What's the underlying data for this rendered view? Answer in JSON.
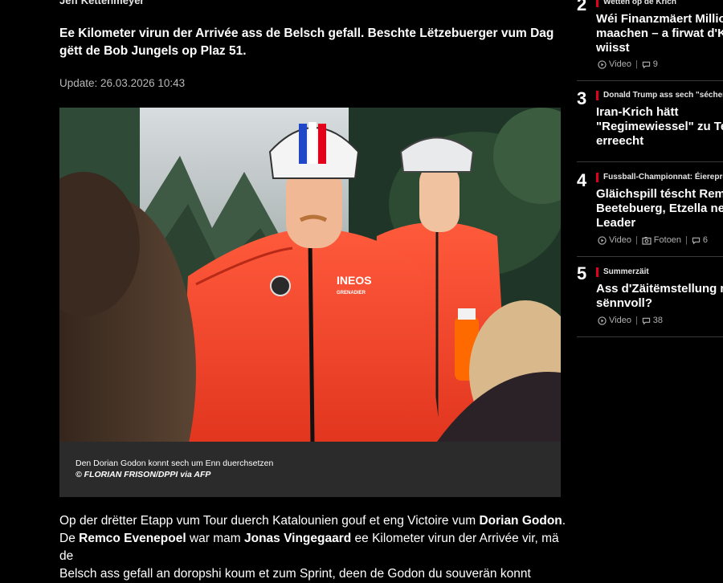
{
  "article": {
    "author": "Jeff Kettenmeyer",
    "lead": "Ee Kilometer virun der Arrivée ass de Belsch gefall. Beschte Lëtzebuerger vum Dag gëtt de Bob Jungels op Plaz 51.",
    "update": "Update: 26.03.2026 10:43",
    "caption": "Den Dorian Godon konnt sech um Enn duerchsetzen",
    "credit": "© FLORIAN FRISON/DPPI via AFP",
    "jersey_text": "INEOS",
    "jersey_sub": "GRENADIER",
    "body": {
      "p1": "Op der drëtter Etapp vum Tour duerch Katalounien gouf et eng Victoire vum ",
      "n1": "Dorian Godon",
      "p2": ".",
      "p3": "De ",
      "n2": "Remco Evenepoel",
      "p4": " war mam ",
      "n3": "Jonas Vingegaard",
      "p5": " ee Kilometer virun der Arrivée vir, mä de",
      "p6": "Belsch ass gefall an doropshi koum et zum Sprint, deen de Godon du souverän konnt"
    }
  },
  "sidebar": {
    "items": [
      {
        "num": "2",
        "kicker": "Wetten op de Krich",
        "title1": "Wéi Finanzmäert Millio",
        "title2": "maachen – a firwat d'K",
        "title3": "wiisst",
        "video": "Video",
        "comments": "9"
      },
      {
        "num": "3",
        "kicker": "Donald Trump ass sech \"sécher\"",
        "title1": "Iran-Krich hätt",
        "title2": "\"Regimewiessel\" zu Teh",
        "title3": "erreecht"
      },
      {
        "num": "4",
        "kicker": "Fussball-Championnat: Éierepromo",
        "title1": "Gläichspill téscht Rem",
        "title2": "Beetebuerg, Etzella ne",
        "title3": "Leader",
        "video": "Video",
        "photos": "Fotoen",
        "comments": "6"
      },
      {
        "num": "5",
        "kicker": "Summerzäit",
        "title1": "Ass d'Zäitëmstellung n",
        "title2": "sënnvoll?",
        "video": "Video",
        "comments": "38"
      }
    ]
  },
  "colors": {
    "accent": "#e3001b",
    "background": "#000000",
    "caption_bg": "#2b2b2b"
  },
  "icons": [
    "play-icon",
    "photo-icon",
    "comment-icon"
  ]
}
